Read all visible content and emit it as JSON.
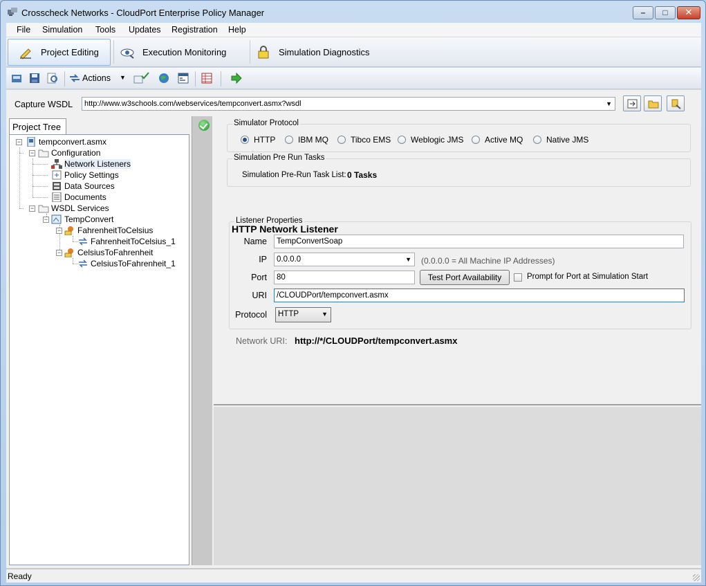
{
  "window": {
    "title": "Crosscheck Networks - CloudPort Enterprise Policy Manager"
  },
  "menu": [
    "File",
    "Simulation",
    "Tools",
    "Updates",
    "Registration",
    "Help"
  ],
  "ribbon_tabs": [
    {
      "label": "Project Editing",
      "active": true,
      "icon": "pencil-icon"
    },
    {
      "label": "Execution Monitoring",
      "active": false,
      "icon": "eye-icon"
    },
    {
      "label": "Simulation Diagnostics",
      "active": false,
      "icon": "lock-icon"
    }
  ],
  "toolbar": {
    "actions_label": "Actions"
  },
  "capture": {
    "label": "Capture WSDL",
    "url": "http://www.w3schools.com/webservices/tempconvert.asmx?wsdl"
  },
  "tree": {
    "tab_label": "Project Tree",
    "nodes": [
      "tempconvert.asmx",
      "Configuration",
      "Network Listeners",
      "Policy Settings",
      "Data Sources",
      "Documents",
      "WSDL Services",
      "TempConvert",
      "FahrenheitToCelsius",
      "FahrenheitToCelsius_1",
      "CelsiusToFahrenheit",
      "CelsiusToFahrenheit_1"
    ]
  },
  "protocol": {
    "title": "Simulator Protocol",
    "options": [
      "HTTP",
      "IBM MQ",
      "Tibco EMS",
      "Weblogic JMS",
      "Active MQ",
      "Native JMS"
    ],
    "selected": "HTTP"
  },
  "prerun": {
    "title": "Simulation Pre Run Tasks",
    "label": "Simulation Pre-Run Task List:",
    "value": "0 Tasks"
  },
  "listener": {
    "heading": "HTTP Network Listener",
    "group_title": "Listener Properties",
    "name_label": "Name",
    "name_value": "TempConvertSoap",
    "ip_label": "IP",
    "ip_value": "0.0.0.0",
    "ip_hint": "(0.0.0.0 = All Machine IP Addresses)",
    "port_label": "Port",
    "port_value": "80",
    "test_port_button": "Test Port Availability",
    "prompt_label": "Prompt for Port at Simulation Start",
    "prompt_checked": false,
    "uri_label": "URI",
    "uri_value": "/CLOUDPort/tempconvert.asmx",
    "protocol_label": "Protocol",
    "protocol_value": "HTTP",
    "network_uri_label": "Network URI:",
    "network_uri_value": "http://*/CLOUDPort/tempconvert.asmx"
  },
  "status": {
    "text": "Ready"
  }
}
